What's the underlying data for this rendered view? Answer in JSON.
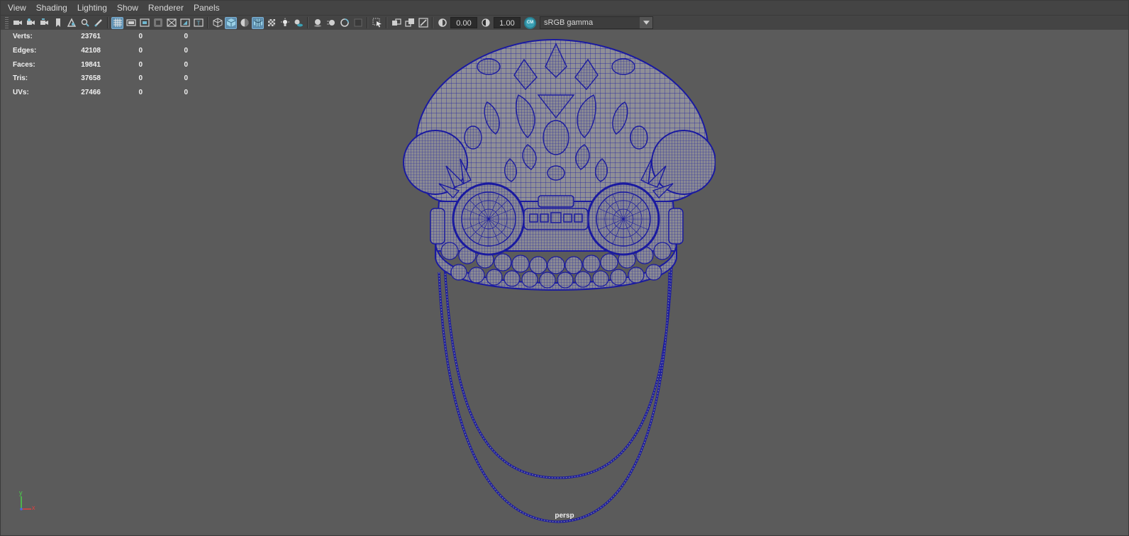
{
  "menu": [
    "View",
    "Shading",
    "Lighting",
    "Show",
    "Renderer",
    "Panels"
  ],
  "toolbar": {
    "exposure": "0.00",
    "gamma": "1.00",
    "color_management_badge": "CM",
    "color_space": "sRGB gamma"
  },
  "hud": {
    "rows": [
      {
        "label": "Verts:",
        "value": "23761",
        "selected": "0",
        "component": "0"
      },
      {
        "label": "Edges:",
        "value": "42108",
        "selected": "0",
        "component": "0"
      },
      {
        "label": "Faces:",
        "value": "19841",
        "selected": "0",
        "component": "0"
      },
      {
        "label": "Tris:",
        "value": "37658",
        "selected": "0",
        "component": "0"
      },
      {
        "label": "UVs:",
        "value": "27466",
        "selected": "0",
        "component": "0"
      }
    ]
  },
  "viewport": {
    "camera": "persp",
    "axis_y": "y",
    "axis_x": "x"
  },
  "colors": {
    "wire": "#1a1aa0",
    "surface": "#8f8f96",
    "viewport_bg": "#5b5b5b",
    "ui_bg": "#444444",
    "active_icon": "#5e8fb0"
  }
}
